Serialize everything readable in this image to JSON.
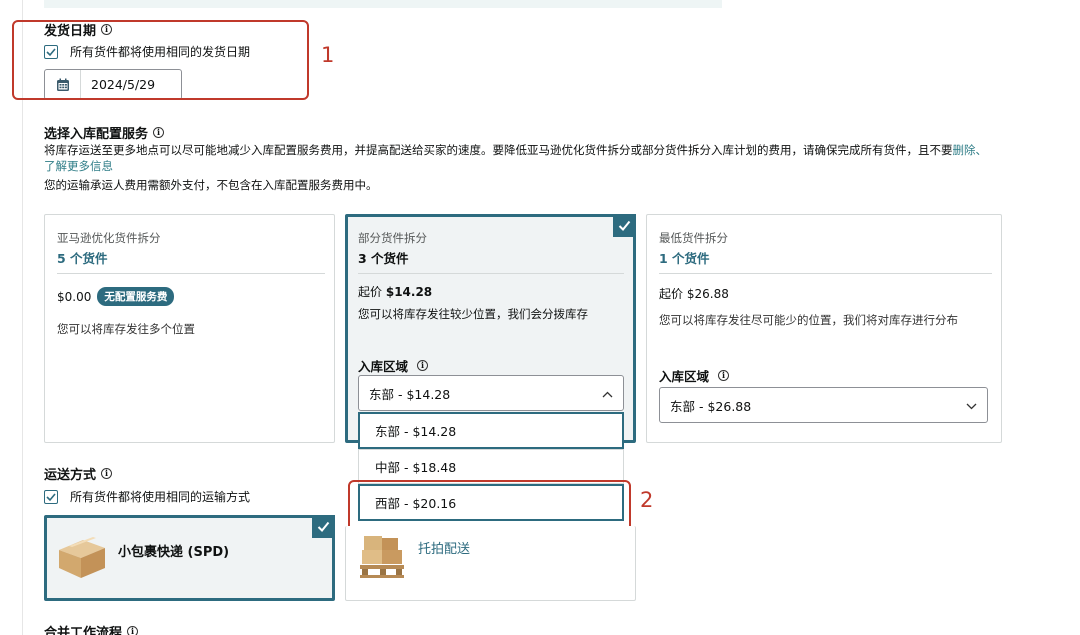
{
  "ship_date": {
    "title": "发货日期",
    "same_date_checkbox_label": "所有货件都将使用相同的发货日期",
    "date_value": "2024/5/29"
  },
  "annotations": {
    "marker_1": "1",
    "marker_2": "2",
    "highlight_color": "#c0392b"
  },
  "placement": {
    "title": "选择入库配置服务",
    "desc_line1": "将库存运送至更多地点可以尽可能地减少入库配置服务费用，并提高配送给买家的速度。要降低亚马逊优化货件拆分或部分货件拆分入库计划的费用，请确保完成所有货件，且不要",
    "desc_link_inline": "删除、",
    "learn_more": "了解更多信息",
    "desc_line2": "您的运输承运人费用需额外支付，不包含在入库配置服务费用中。",
    "options": [
      {
        "label": "亚马逊优化货件拆分",
        "count": "5 个货件",
        "price": "$0.00",
        "badge": "无配置服务费",
        "desc": "您可以将库存发往多个位置"
      },
      {
        "label": "部分货件拆分",
        "count": "3 个货件",
        "price_prefix": "起价",
        "price": "$14.28",
        "desc": "您可以将库存发往较少位置，我们会分拨库存",
        "region_label": "入库区域",
        "region_value": "东部 - $14.28",
        "selected": true
      },
      {
        "label": "最低货件拆分",
        "count": "1 个货件",
        "price_prefix": "起价",
        "price": "$26.88",
        "desc": "您可以将库存发往尽可能少的位置，我们将对库存进行分布",
        "region_label": "入库区域",
        "region_value": "东部 - $26.88"
      }
    ],
    "region_dropdown_options": [
      "东部 - $14.28",
      "中部 - $18.48",
      "西部 - $20.16"
    ]
  },
  "shipping": {
    "title": "运送方式",
    "same_method_checkbox_label": "所有货件都将使用相同的运输方式",
    "methods": [
      {
        "name": "小包裹快递 (SPD)",
        "selected": true,
        "icon": "box-icon"
      },
      {
        "name": "托拍配送",
        "selected": false,
        "icon": "pallet-icon"
      }
    ]
  },
  "merge": {
    "title": "合并工作流程"
  },
  "colors": {
    "accent": "#2d6b7f",
    "link": "#2f7d87"
  }
}
